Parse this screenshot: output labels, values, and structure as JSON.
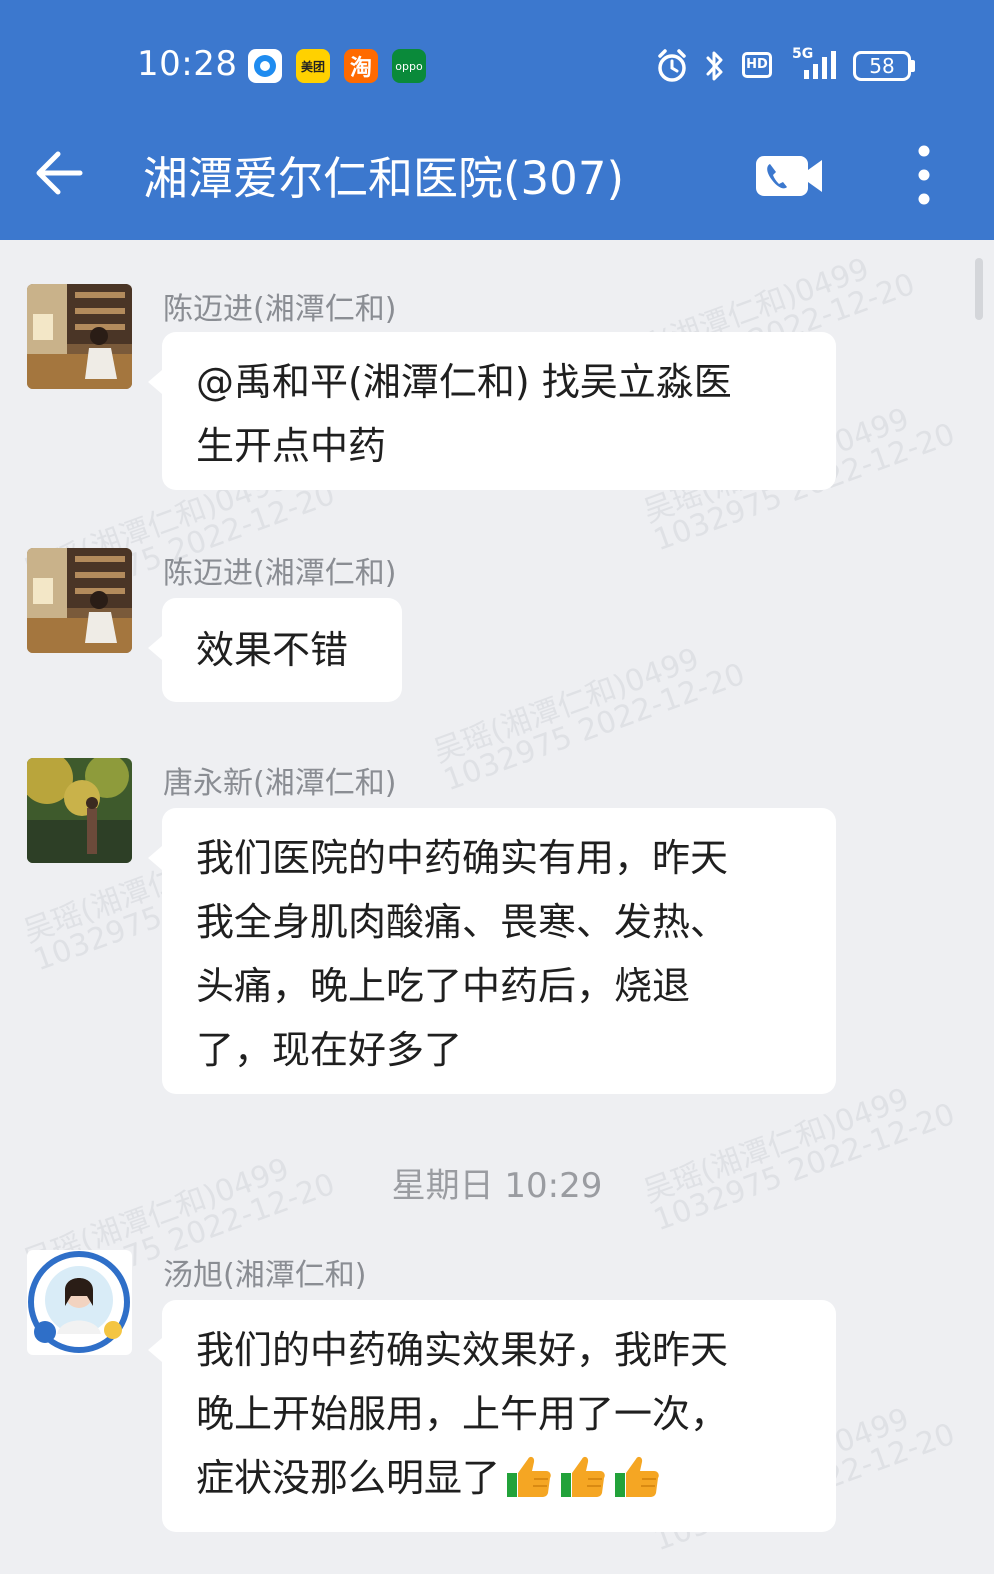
{
  "status_bar": {
    "time": "10:28",
    "apps": [
      {
        "name": "qq-browser",
        "label": ""
      },
      {
        "name": "meituan",
        "label": "美团"
      },
      {
        "name": "taobao",
        "label": "淘"
      },
      {
        "name": "oppo",
        "label": "oppo"
      }
    ],
    "hd_label": "HD",
    "network_label": "5G",
    "battery_level": "58"
  },
  "header": {
    "title": "湘潭爱尔仁和医院(307)"
  },
  "watermark": {
    "line1": "吴瑶(湘潭仁和)0499",
    "line2": "1032975 2022-12-20"
  },
  "messages": [
    {
      "sender": "陈迈进(湘潭仁和)",
      "lines": [
        "@禹和平(湘潭仁和) 找吴立淼医",
        "生开点中药"
      ]
    },
    {
      "sender": "陈迈进(湘潭仁和)",
      "lines": [
        "效果不错"
      ]
    },
    {
      "sender": "唐永新(湘潭仁和)",
      "lines": [
        "我们医院的中药确实有用，昨天",
        "我全身肌肉酸痛、畏寒、发热、",
        "头痛，晚上吃了中药后，烧退",
        "了，现在好多了"
      ]
    },
    {
      "sender": "汤旭(湘潭仁和)",
      "lines": [
        "我们的中药确实效果好，我昨天",
        "晚上开始服用，上午用了一次，",
        "症状没那么明显了"
      ]
    }
  ],
  "time_divider": "星期日  10:29",
  "emoji": {
    "name": "thumbs-up",
    "count": 3
  },
  "colors": {
    "header_bg": "#3c78ce",
    "chat_bg": "#eeeff2",
    "bubble_bg": "#ffffff"
  }
}
